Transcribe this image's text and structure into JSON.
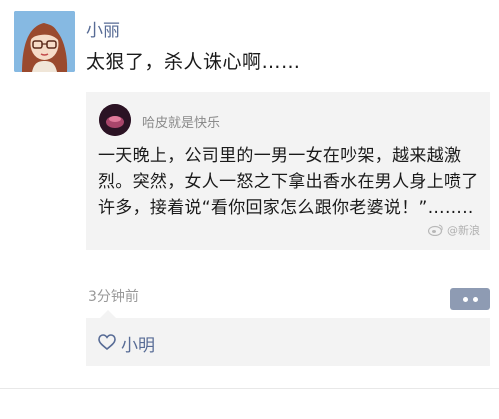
{
  "post": {
    "author": "小丽",
    "text": "太狠了，杀人诛心啊……",
    "timestamp": "3分钟前"
  },
  "shared": {
    "username": "哈皮就是快乐",
    "body": "一天晚上，公司里的一男一女在吵架，越来越激烈。突然，女人一怒之下拿出香水在男人身上喷了许多，接着说“看你回家怎么跟你老婆说！”……..",
    "watermark": "@新浪"
  },
  "likes": {
    "users": [
      "小明"
    ]
  },
  "colors": {
    "link_blue": "#576b95",
    "card_bg": "#f3f3f3",
    "comment_button": "#8e9bb3"
  },
  "icons": [
    "avatar-girl",
    "shared-avatar",
    "weibo-logo-icon",
    "comment-dots-icon",
    "heart-icon"
  ]
}
